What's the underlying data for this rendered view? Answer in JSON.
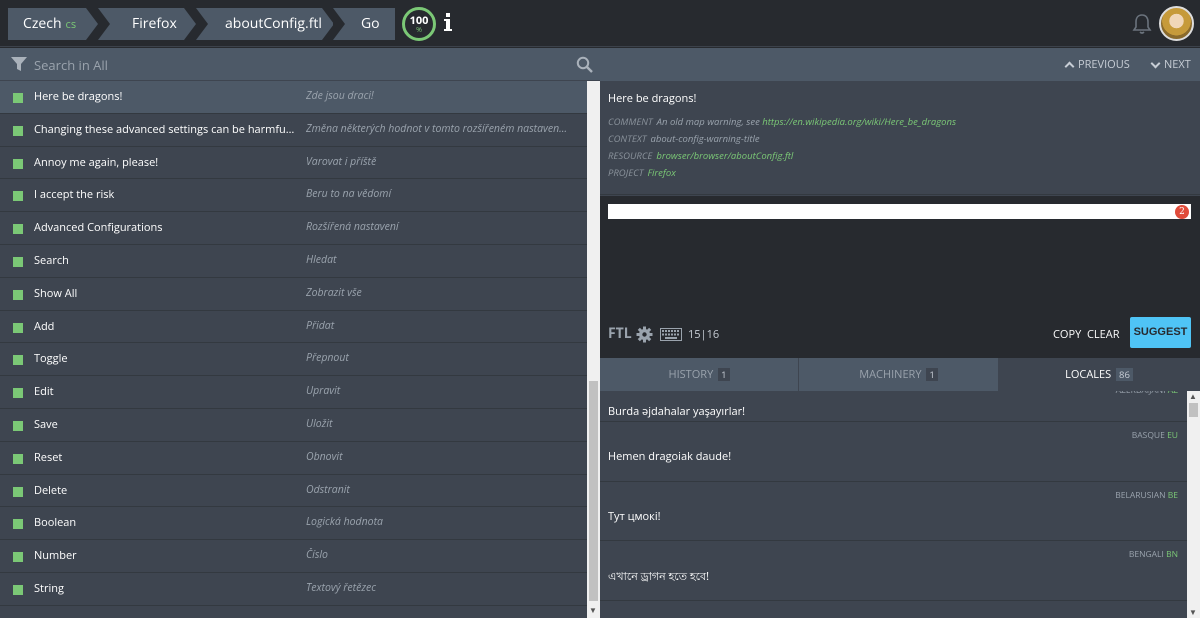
{
  "header": {
    "locale": {
      "name": "Czech",
      "code": "cs"
    },
    "project": "Firefox",
    "resource": "aboutConfig.ftl",
    "go_label": "Go",
    "progress": {
      "percent": "100",
      "sign": "%"
    }
  },
  "search": {
    "placeholder": "Search in All"
  },
  "entities": [
    {
      "source": "Here be dragons!",
      "translation": "Zde jsou draci!",
      "status": "translated",
      "selected": true
    },
    {
      "source": "Changing these advanced settings can be harmful to …",
      "translation": "Změna některých hodnot v tomto rozšířeném nastavení …",
      "status": "translated"
    },
    {
      "source": "Annoy me again, please!",
      "translation": "Varovat i příště",
      "status": "translated"
    },
    {
      "source": "I accept the risk",
      "translation": "Beru to na vědomí",
      "status": "translated"
    },
    {
      "source": "Advanced Configurations",
      "translation": "Rozšířená nastavení",
      "status": "translated"
    },
    {
      "source": "Search",
      "translation": "Hledat",
      "status": "translated"
    },
    {
      "source": "Show All",
      "translation": "Zobrazit vše",
      "status": "translated"
    },
    {
      "source": "Add",
      "translation": "Přidat",
      "status": "translated"
    },
    {
      "source": "Toggle",
      "translation": "Přepnout",
      "status": "translated"
    },
    {
      "source": "Edit",
      "translation": "Upravit",
      "status": "translated"
    },
    {
      "source": "Save",
      "translation": "Uložit",
      "status": "translated"
    },
    {
      "source": "Reset",
      "translation": "Obnovit",
      "status": "translated"
    },
    {
      "source": "Delete",
      "translation": "Odstranit",
      "status": "translated"
    },
    {
      "source": "Boolean",
      "translation": "Logická hodnota",
      "status": "translated"
    },
    {
      "source": "Number",
      "translation": "Číslo",
      "status": "translated"
    },
    {
      "source": "String",
      "translation": "Textový řetězec",
      "status": "translated"
    }
  ],
  "navigation": {
    "previous": "PREVIOUS",
    "next": "NEXT"
  },
  "metadata": {
    "original": "Here be dragons!",
    "comment_key": "COMMENT",
    "comment_text": "An old map warning, see",
    "comment_link": "https://en.wikipedia.org/wiki/Here_be_dragons",
    "context_key": "CONTEXT",
    "context_value": "about-config-warning-title",
    "resource_key": "RESOURCE",
    "resource_value": "browser/browser/aboutConfig.ftl",
    "project_key": "PROJECT",
    "project_value": "Firefox"
  },
  "editor": {
    "value": "",
    "badge_count": "2",
    "ftl_label": "FTL",
    "char_counter": "15|16",
    "copy_label": "COPY",
    "clear_label": "CLEAR",
    "suggest_label": "SUGGEST"
  },
  "tabs": [
    {
      "label": "HISTORY",
      "count": "1"
    },
    {
      "label": "MACHINERY",
      "count": "1"
    },
    {
      "label": "LOCALES",
      "count": "86",
      "active": true
    }
  ],
  "locales": [
    {
      "name": "AZERBAIJANI",
      "code": "AZ",
      "text": "Burda əjdahalar yaşayırlar!"
    },
    {
      "name": "BASQUE",
      "code": "EU",
      "text": "Hemen dragoiak daude!"
    },
    {
      "name": "BELARUSIAN",
      "code": "BE",
      "text": "Тут цмокі!"
    },
    {
      "name": "BENGALI",
      "code": "BN",
      "text": "এখানে ড্রাগন হতে হবে!"
    }
  ],
  "colors": {
    "accent_green": "#7bc876",
    "suggest_blue": "#4fc4f6",
    "badge_red": "#e04b3a"
  }
}
